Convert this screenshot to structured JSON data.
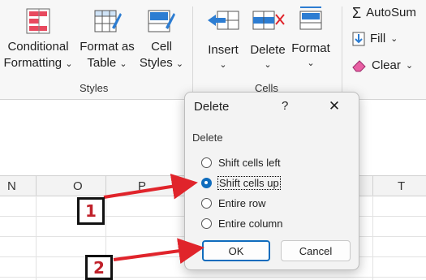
{
  "ribbon": {
    "styles_group": {
      "conditional_formatting": [
        "Conditional",
        "Formatting"
      ],
      "format_as_table": [
        "Format as",
        "Table"
      ],
      "cell_styles": [
        "Cell",
        "Styles"
      ],
      "label": "Styles"
    },
    "cells_group": {
      "insert": "Insert",
      "delete": "Delete",
      "format": "Format",
      "label": "Cells"
    },
    "editing_group": {
      "autosum": "AutoSum",
      "fill": "Fill",
      "clear": "Clear"
    }
  },
  "sheet": {
    "columns": [
      "N",
      "O",
      "P",
      "T"
    ]
  },
  "dialog": {
    "title": "Delete",
    "help": "?",
    "close": "✕",
    "section": "Delete",
    "options": [
      {
        "label": "Shift cells left",
        "checked": false
      },
      {
        "label": "Shift cells up",
        "checked": true
      },
      {
        "label": "Entire row",
        "checked": false
      },
      {
        "label": "Entire column",
        "checked": false
      }
    ],
    "ok": "OK",
    "cancel": "Cancel"
  },
  "annotations": {
    "step1": "1",
    "step2": "2",
    "arrow_color": "#e0242b"
  },
  "colors": {
    "accent": "#0f6cbd",
    "callout_text": "#c0212a"
  }
}
